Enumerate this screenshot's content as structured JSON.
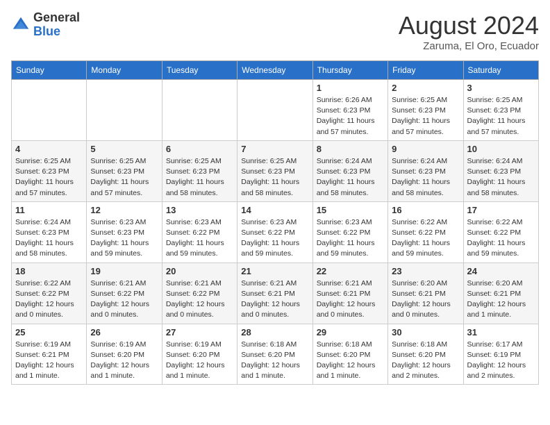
{
  "logo": {
    "general": "General",
    "blue": "Blue"
  },
  "title": "August 2024",
  "location": "Zaruma, El Oro, Ecuador",
  "days_of_week": [
    "Sunday",
    "Monday",
    "Tuesday",
    "Wednesday",
    "Thursday",
    "Friday",
    "Saturday"
  ],
  "weeks": [
    [
      {
        "day": "",
        "info": ""
      },
      {
        "day": "",
        "info": ""
      },
      {
        "day": "",
        "info": ""
      },
      {
        "day": "",
        "info": ""
      },
      {
        "day": "1",
        "info": "Sunrise: 6:26 AM\nSunset: 6:23 PM\nDaylight: 11 hours and 57 minutes."
      },
      {
        "day": "2",
        "info": "Sunrise: 6:25 AM\nSunset: 6:23 PM\nDaylight: 11 hours and 57 minutes."
      },
      {
        "day": "3",
        "info": "Sunrise: 6:25 AM\nSunset: 6:23 PM\nDaylight: 11 hours and 57 minutes."
      }
    ],
    [
      {
        "day": "4",
        "info": "Sunrise: 6:25 AM\nSunset: 6:23 PM\nDaylight: 11 hours and 57 minutes."
      },
      {
        "day": "5",
        "info": "Sunrise: 6:25 AM\nSunset: 6:23 PM\nDaylight: 11 hours and 57 minutes."
      },
      {
        "day": "6",
        "info": "Sunrise: 6:25 AM\nSunset: 6:23 PM\nDaylight: 11 hours and 58 minutes."
      },
      {
        "day": "7",
        "info": "Sunrise: 6:25 AM\nSunset: 6:23 PM\nDaylight: 11 hours and 58 minutes."
      },
      {
        "day": "8",
        "info": "Sunrise: 6:24 AM\nSunset: 6:23 PM\nDaylight: 11 hours and 58 minutes."
      },
      {
        "day": "9",
        "info": "Sunrise: 6:24 AM\nSunset: 6:23 PM\nDaylight: 11 hours and 58 minutes."
      },
      {
        "day": "10",
        "info": "Sunrise: 6:24 AM\nSunset: 6:23 PM\nDaylight: 11 hours and 58 minutes."
      }
    ],
    [
      {
        "day": "11",
        "info": "Sunrise: 6:24 AM\nSunset: 6:23 PM\nDaylight: 11 hours and 58 minutes."
      },
      {
        "day": "12",
        "info": "Sunrise: 6:23 AM\nSunset: 6:23 PM\nDaylight: 11 hours and 59 minutes."
      },
      {
        "day": "13",
        "info": "Sunrise: 6:23 AM\nSunset: 6:22 PM\nDaylight: 11 hours and 59 minutes."
      },
      {
        "day": "14",
        "info": "Sunrise: 6:23 AM\nSunset: 6:22 PM\nDaylight: 11 hours and 59 minutes."
      },
      {
        "day": "15",
        "info": "Sunrise: 6:23 AM\nSunset: 6:22 PM\nDaylight: 11 hours and 59 minutes."
      },
      {
        "day": "16",
        "info": "Sunrise: 6:22 AM\nSunset: 6:22 PM\nDaylight: 11 hours and 59 minutes."
      },
      {
        "day": "17",
        "info": "Sunrise: 6:22 AM\nSunset: 6:22 PM\nDaylight: 11 hours and 59 minutes."
      }
    ],
    [
      {
        "day": "18",
        "info": "Sunrise: 6:22 AM\nSunset: 6:22 PM\nDaylight: 12 hours and 0 minutes."
      },
      {
        "day": "19",
        "info": "Sunrise: 6:21 AM\nSunset: 6:22 PM\nDaylight: 12 hours and 0 minutes."
      },
      {
        "day": "20",
        "info": "Sunrise: 6:21 AM\nSunset: 6:22 PM\nDaylight: 12 hours and 0 minutes."
      },
      {
        "day": "21",
        "info": "Sunrise: 6:21 AM\nSunset: 6:21 PM\nDaylight: 12 hours and 0 minutes."
      },
      {
        "day": "22",
        "info": "Sunrise: 6:21 AM\nSunset: 6:21 PM\nDaylight: 12 hours and 0 minutes."
      },
      {
        "day": "23",
        "info": "Sunrise: 6:20 AM\nSunset: 6:21 PM\nDaylight: 12 hours and 0 minutes."
      },
      {
        "day": "24",
        "info": "Sunrise: 6:20 AM\nSunset: 6:21 PM\nDaylight: 12 hours and 1 minute."
      }
    ],
    [
      {
        "day": "25",
        "info": "Sunrise: 6:19 AM\nSunset: 6:21 PM\nDaylight: 12 hours and 1 minute."
      },
      {
        "day": "26",
        "info": "Sunrise: 6:19 AM\nSunset: 6:20 PM\nDaylight: 12 hours and 1 minute."
      },
      {
        "day": "27",
        "info": "Sunrise: 6:19 AM\nSunset: 6:20 PM\nDaylight: 12 hours and 1 minute."
      },
      {
        "day": "28",
        "info": "Sunrise: 6:18 AM\nSunset: 6:20 PM\nDaylight: 12 hours and 1 minute."
      },
      {
        "day": "29",
        "info": "Sunrise: 6:18 AM\nSunset: 6:20 PM\nDaylight: 12 hours and 1 minute."
      },
      {
        "day": "30",
        "info": "Sunrise: 6:18 AM\nSunset: 6:20 PM\nDaylight: 12 hours and 2 minutes."
      },
      {
        "day": "31",
        "info": "Sunrise: 6:17 AM\nSunset: 6:19 PM\nDaylight: 12 hours and 2 minutes."
      }
    ]
  ]
}
